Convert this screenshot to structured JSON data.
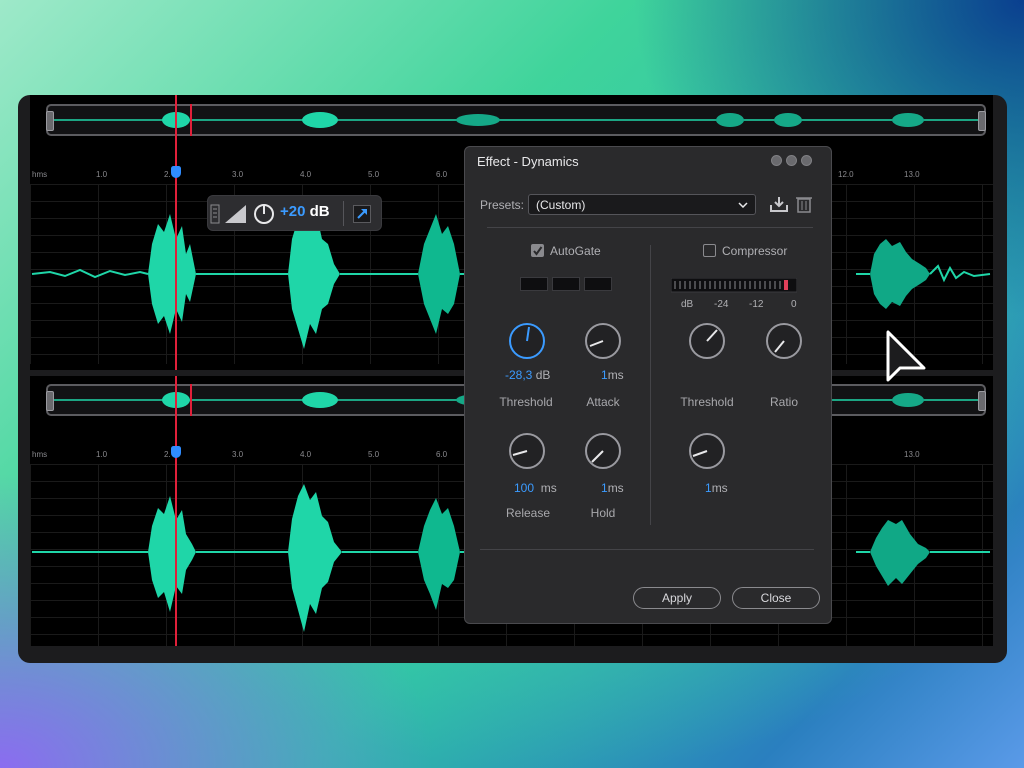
{
  "colors": {
    "waveform": "#1fd6a8",
    "playhead": "#e0203a",
    "accent": "#3b9bff",
    "panel": "#2a2a2c"
  },
  "timeline": {
    "unit_label": "hms",
    "ticks_top": [
      "1.0",
      "2.",
      "3.0",
      "4.0",
      "5.0",
      "6.0",
      "12.0",
      "13.0"
    ],
    "ticks_bottom": [
      "1.0",
      "2.",
      "3.0",
      "4.0",
      "5.0",
      "6.0",
      "13.0"
    ]
  },
  "floatbar": {
    "gain_value": "+20",
    "gain_unit": "dB",
    "icons": [
      "drag-handle-icon",
      "fade-ramp-icon",
      "power-icon",
      "expand-arrow-icon"
    ]
  },
  "dialog": {
    "title": "Effect - Dynamics",
    "presets_label": "Presets:",
    "preset_value": "(Custom)",
    "icons": [
      "save-preset-icon",
      "delete-preset-icon"
    ],
    "autogate": {
      "label": "AutoGate",
      "checked": true,
      "threshold": {
        "value": "-28,3",
        "unit": "dB",
        "label": "Threshold"
      },
      "attack": {
        "value": "1",
        "unit": "ms",
        "label": "Attack"
      },
      "release": {
        "value": "100",
        "unit": "ms",
        "label": "Release"
      },
      "hold": {
        "value": "1",
        "unit": "ms",
        "label": "Hold"
      }
    },
    "compressor": {
      "label": "Compressor",
      "checked": false,
      "meter_labels": [
        "dB",
        "-24",
        "-12",
        "0"
      ],
      "threshold_label": "Threshold",
      "ratio_label": "Ratio",
      "gain": {
        "value": "1",
        "unit": "ms"
      }
    },
    "apply_label": "Apply",
    "close_label": "Close"
  }
}
